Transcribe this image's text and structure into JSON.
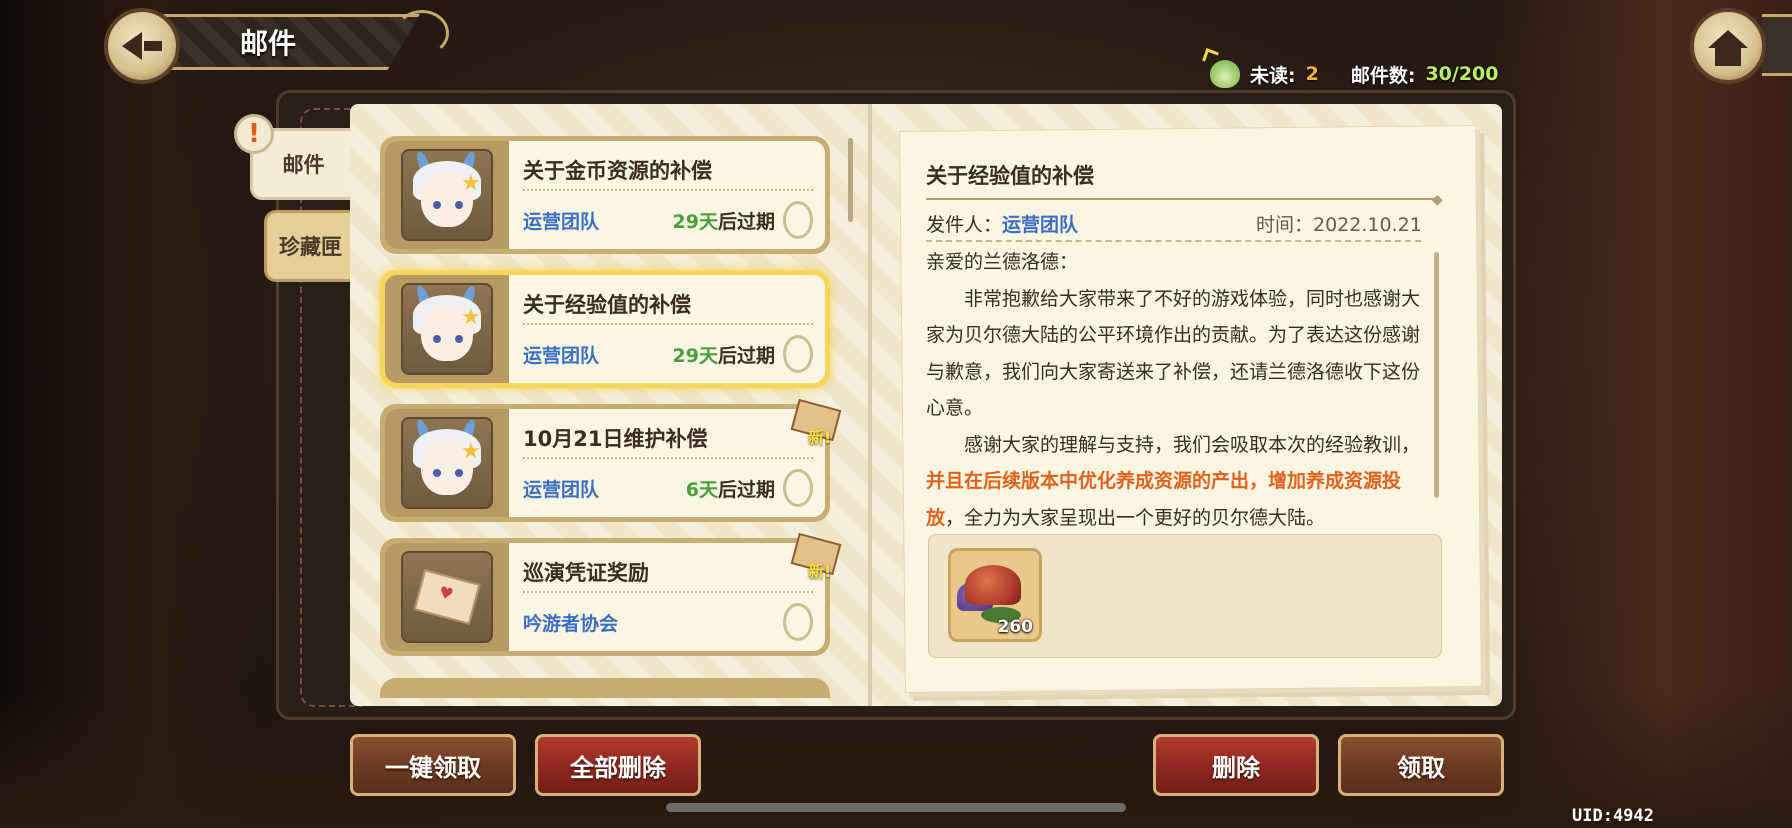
{
  "header": {
    "title": "邮件"
  },
  "counts": {
    "unread_label": "未读:",
    "unread_value": "2",
    "total_label": "邮件数:",
    "total_value": "30/200"
  },
  "tabs": [
    {
      "label": "邮件"
    },
    {
      "label": "珍藏匣"
    }
  ],
  "tab_alert": "!",
  "mails": [
    {
      "title": "关于金币资源的补偿",
      "sender": "运营团队",
      "days": "29天",
      "expire_suffix": "后过期",
      "selected": false,
      "is_new": false
    },
    {
      "title": "关于经验值的补偿",
      "sender": "运营团队",
      "days": "29天",
      "expire_suffix": "后过期",
      "selected": true,
      "is_new": false
    },
    {
      "title": "10月21日维护补偿",
      "sender": "运营团队",
      "days": "6天",
      "expire_suffix": "后过期",
      "selected": false,
      "is_new": true
    },
    {
      "title": "巡演凭证奖励",
      "sender": "吟游者协会",
      "days": "",
      "expire_suffix": "",
      "selected": false,
      "is_new": true
    }
  ],
  "new_label": "新!",
  "letter": {
    "title": "关于经验值的补偿",
    "sender_label": "发件人：",
    "sender": "运营团队",
    "time": "时间：2022.10.21",
    "greeting": "亲爱的兰德洛德：",
    "para1": "非常抱歉给大家带来了不好的游戏体验，同时也感谢大家为贝尔德大陆的公平环境作出的贡献。为了表达这份感谢与歉意，我们向大家寄送来了补偿，还请兰德洛德收下这份心意。",
    "para2_a": "感谢大家的理解与支持，我们会吸取本次的经验教训，",
    "para2_highlight": "并且在后续版本中优化养成资源的产出，增加养成资源投放",
    "para2_b": "，全力为大家呈现出一个更好的贝尔德大陆。",
    "attachment": {
      "icon": "mushroom-icon",
      "count": "260"
    }
  },
  "buttons": {
    "claim_all": "一键领取",
    "delete_all": "全部删除",
    "delete": "删除",
    "claim": "领取"
  },
  "uid": "UID:4942",
  "colors": {
    "highlight": "#e2621c",
    "sender_blue": "#3a6fc1",
    "days_green": "#4a9f3a",
    "unread_orange": "#ffb23a",
    "total_green": "#b9f06a"
  }
}
